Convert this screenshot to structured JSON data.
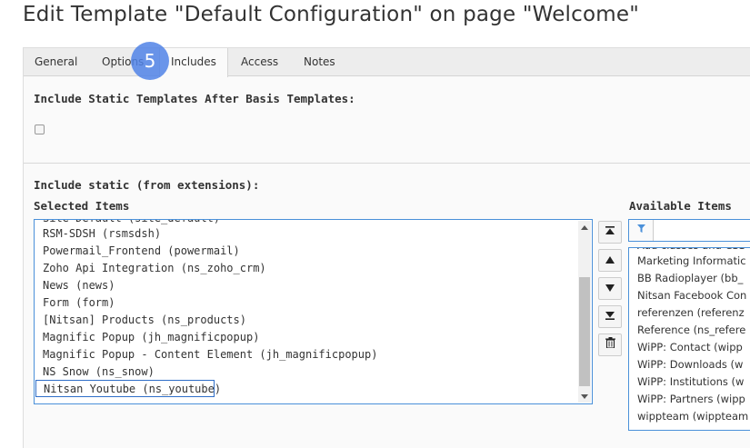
{
  "page_title": "Edit Template \"Default Configuration\" on page \"Welcome\"",
  "tabs": [
    {
      "label": "General"
    },
    {
      "label": "Options"
    },
    {
      "label": "Includes"
    },
    {
      "label": "Access"
    },
    {
      "label": "Notes"
    }
  ],
  "active_tab": "Includes",
  "step_badge": "5",
  "include_after_label": "Include Static Templates After Basis Templates:",
  "include_after_checked": false,
  "include_static_label": "Include static (from extensions):",
  "selected_items_label": "Selected Items",
  "available_items_label": "Available Items",
  "selected_items": [
    "Site Default (site_default)",
    "RSM-SDSH (rsmsdsh)",
    "Powermail_Frontend (powermail)",
    "Zoho Api Integration (ns_zoho_crm)",
    "News (news)",
    "Form (form)",
    "[Nitsan] Products (ns_products)",
    "Magnific Popup (jh_magnificpopup)",
    "Magnific Popup - Content Element (jh_magnificpopup)",
    "NS Snow (ns_snow)",
    "Nitsan Youtube (ns_youtube)"
  ],
  "selected_highlight": "Nitsan Youtube (ns_youtube)",
  "available_items": [
    "Add classes and CSS",
    "Marketing Informatic",
    "BB Radioplayer (bb_",
    "Nitsan Facebook Con",
    "referenzen (referenz",
    "Reference (ns_refere",
    "WiPP: Contact (wipp",
    "WiPP: Downloads (w",
    "WiPP: Institutions (w",
    "WiPP: Partners (wipp",
    "wippteam (wippteam"
  ],
  "controls": {
    "move_top": "⏶",
    "move_up": "▲",
    "move_down": "▼",
    "move_bottom": "⏷",
    "remove": "🗑"
  },
  "filter_icon": "▼",
  "colors": {
    "accent": "#4a90d9",
    "selected_border": "#2f6ec8",
    "badge": "#5082e6"
  }
}
